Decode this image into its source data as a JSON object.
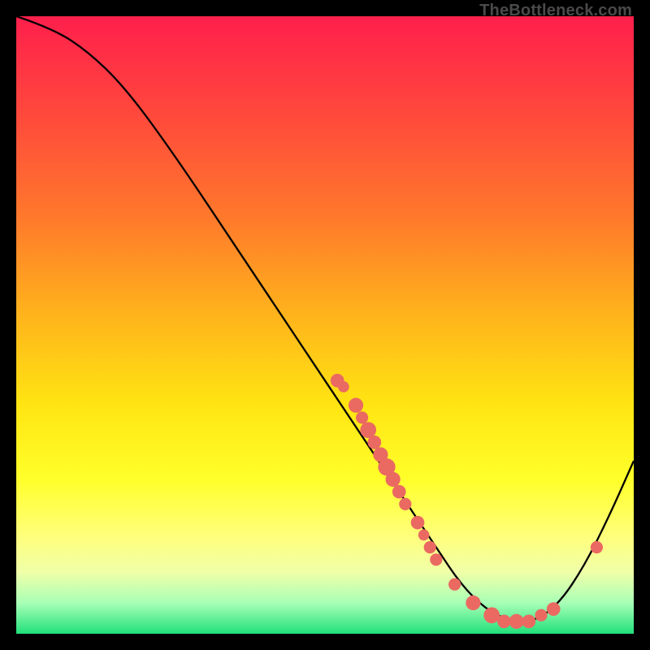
{
  "attribution": "TheBottleneck.com",
  "chart_data": {
    "type": "line",
    "title": "",
    "xlabel": "",
    "ylabel": "",
    "xlim": [
      0,
      100
    ],
    "ylim": [
      0,
      100
    ],
    "grid": false,
    "curve": [
      {
        "x": 0,
        "y": 100
      },
      {
        "x": 6,
        "y": 98
      },
      {
        "x": 12,
        "y": 94
      },
      {
        "x": 18,
        "y": 88
      },
      {
        "x": 26,
        "y": 77
      },
      {
        "x": 36,
        "y": 62
      },
      {
        "x": 46,
        "y": 47
      },
      {
        "x": 56,
        "y": 32
      },
      {
        "x": 62,
        "y": 23
      },
      {
        "x": 68,
        "y": 14
      },
      {
        "x": 72,
        "y": 8
      },
      {
        "x": 76,
        "y": 4
      },
      {
        "x": 80,
        "y": 2
      },
      {
        "x": 84,
        "y": 2
      },
      {
        "x": 88,
        "y": 5
      },
      {
        "x": 92,
        "y": 11
      },
      {
        "x": 96,
        "y": 19
      },
      {
        "x": 100,
        "y": 28
      }
    ],
    "points": [
      {
        "x": 52,
        "y": 41,
        "r": 1.1
      },
      {
        "x": 53,
        "y": 40,
        "r": 0.9
      },
      {
        "x": 55,
        "y": 37,
        "r": 1.2
      },
      {
        "x": 56,
        "y": 35,
        "r": 1.0
      },
      {
        "x": 57,
        "y": 33,
        "r": 1.3
      },
      {
        "x": 58,
        "y": 31,
        "r": 1.1
      },
      {
        "x": 59,
        "y": 29,
        "r": 1.2
      },
      {
        "x": 60,
        "y": 27,
        "r": 1.4
      },
      {
        "x": 61,
        "y": 25,
        "r": 1.2
      },
      {
        "x": 62,
        "y": 23,
        "r": 1.1
      },
      {
        "x": 63,
        "y": 21,
        "r": 1.0
      },
      {
        "x": 65,
        "y": 18,
        "r": 1.1
      },
      {
        "x": 66,
        "y": 16,
        "r": 0.9
      },
      {
        "x": 67,
        "y": 14,
        "r": 1.0
      },
      {
        "x": 68,
        "y": 12,
        "r": 1.0
      },
      {
        "x": 71,
        "y": 8,
        "r": 1.0
      },
      {
        "x": 74,
        "y": 5,
        "r": 1.2
      },
      {
        "x": 77,
        "y": 3,
        "r": 1.3
      },
      {
        "x": 79,
        "y": 2,
        "r": 1.1
      },
      {
        "x": 81,
        "y": 2,
        "r": 1.2
      },
      {
        "x": 83,
        "y": 2,
        "r": 1.1
      },
      {
        "x": 85,
        "y": 3,
        "r": 1.0
      },
      {
        "x": 87,
        "y": 4,
        "r": 1.1
      },
      {
        "x": 94,
        "y": 14,
        "r": 1.0
      }
    ],
    "point_color": "#ea6a62",
    "curve_color": "#000000",
    "curve_width": 2.3
  }
}
